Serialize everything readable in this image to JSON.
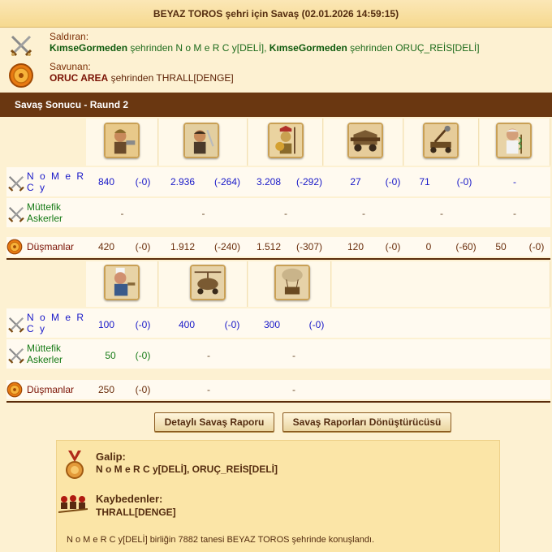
{
  "title": "BEYAZ TOROS şehri için Savaş (02.01.2026 14:59:15)",
  "attacker": {
    "label": "Saldıran:",
    "city1": "KımseGormeden",
    "player1": "şehrinden N o M e R C y[DELİ],",
    "city2": "KımseGormeden",
    "player2": "şehrinden ORUÇ_REİS[DELİ]"
  },
  "defender": {
    "label": "Savunan:",
    "city": "ORUC AREA",
    "player": "şehrinden THRALL[DENGE]"
  },
  "round_title": "Savaş Sonucu - Raund 2",
  "row_labels": {
    "own": "N o M e R C y",
    "allies": "Müttefik Askerler",
    "enemies": "Düşmanlar"
  },
  "block1": {
    "units": [
      "hoplite-soldier",
      "swordsman",
      "spartan-phalanx",
      "battering-ram",
      "catapult",
      "doctor"
    ],
    "own": [
      {
        "count": "840",
        "loss": "(-0)"
      },
      {
        "count": "2.936",
        "loss": "(-264)"
      },
      {
        "count": "3.208",
        "loss": "(-292)"
      },
      {
        "count": "27",
        "loss": "(-0)"
      },
      {
        "count": "71",
        "loss": "(-0)"
      },
      {
        "count": "-",
        "loss": ""
      }
    ],
    "allies": [
      "-",
      "-",
      "-",
      "-",
      "-",
      "-"
    ],
    "enemies": [
      {
        "count": "420",
        "loss": "(-0)"
      },
      {
        "count": "1.912",
        "loss": "(-240)"
      },
      {
        "count": "1.512",
        "loss": "(-307)"
      },
      {
        "count": "120",
        "loss": "(-0)"
      },
      {
        "count": "0",
        "loss": "(-60)"
      },
      {
        "count": "50",
        "loss": "(-0)"
      }
    ]
  },
  "block2": {
    "units": [
      "cook",
      "gyrocopter",
      "balloon-bomber"
    ],
    "own": [
      {
        "count": "100",
        "loss": "(-0)"
      },
      {
        "count": "400",
        "loss": "(-0)"
      },
      {
        "count": "300",
        "loss": "(-0)"
      }
    ],
    "allies": [
      {
        "count": "50",
        "loss": "(-0)"
      },
      {
        "count": "-",
        "loss": ""
      },
      {
        "count": "-",
        "loss": ""
      }
    ],
    "enemies": [
      {
        "count": "250",
        "loss": "(-0)"
      },
      {
        "count": "-",
        "loss": ""
      },
      {
        "count": "-",
        "loss": ""
      }
    ]
  },
  "buttons": {
    "detailed": "Detaylı Savaş Raporu",
    "converter": "Savaş Raporları Dönüştürücüsü"
  },
  "summary": {
    "winner_label": "Galip:",
    "winner_value": "N o M e R C y[DELİ], ORUÇ_REİS[DELİ]",
    "loser_label": "Kaybedenler:",
    "loser_value": "THRALL[DENGE]",
    "footer": "N o M e R C y[DELİ] birliğin 7882 tanesi BEYAZ TOROS şehrinde konuşlandı."
  },
  "colors": {
    "background": "#fdf1d2",
    "header_bar": "#6a3711",
    "own_text": "#1818c8",
    "ally_text": "#167a16",
    "enemy_text": "#7a1204"
  }
}
